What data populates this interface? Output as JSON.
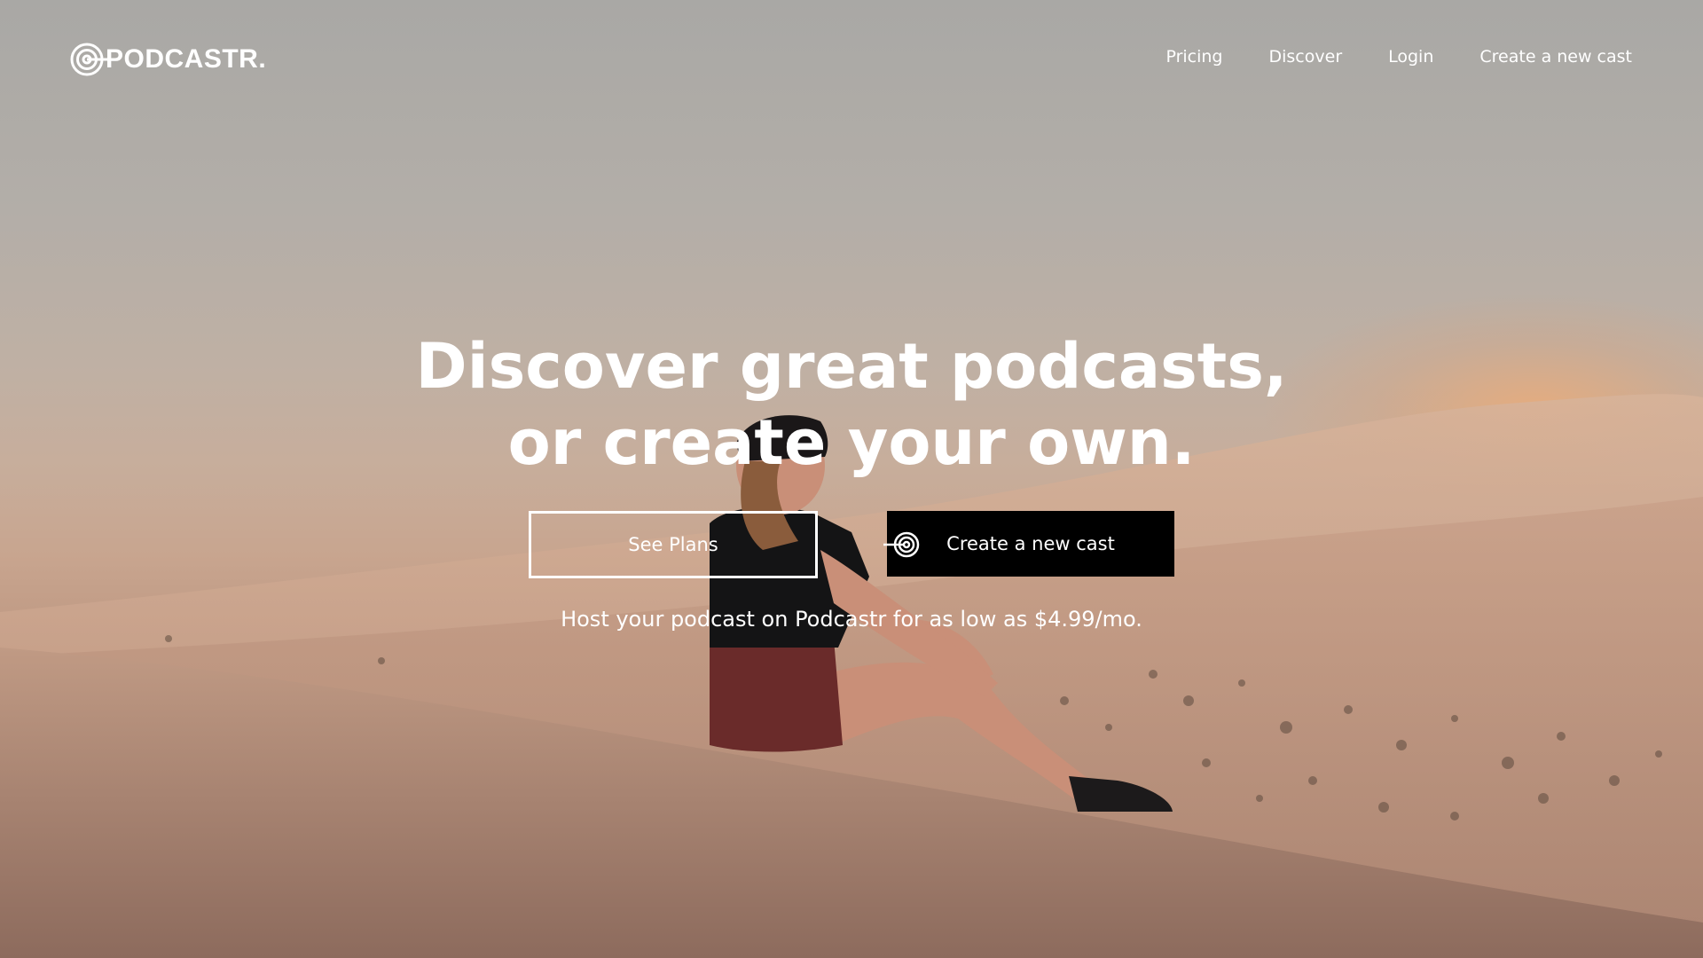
{
  "brand": {
    "name": "PODCASTR.",
    "logo_icon": "target-mic-icon"
  },
  "nav": {
    "items": [
      {
        "label": "Pricing"
      },
      {
        "label": "Discover"
      },
      {
        "label": "Login"
      },
      {
        "label": "Create a new cast"
      }
    ]
  },
  "hero": {
    "headline_line1": "Discover great podcasts,",
    "headline_line2": "or create your own.",
    "see_plans_label": "See Plans",
    "create_label": "Create a new cast",
    "create_icon": "target-icon",
    "subline": "Host your podcast on Podcastr for as low as $4.99/mo."
  },
  "colors": {
    "text": "#ffffff",
    "primary_button_bg": "#000000",
    "sky": "#a9a8a5",
    "sand": "#c8a58f",
    "sun": "#f6aa6e"
  }
}
